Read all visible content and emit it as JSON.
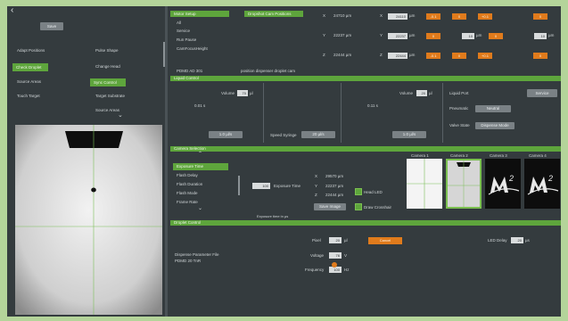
{
  "left_panel": {
    "back_glyph": "‹",
    "save_label": "Save",
    "menu": [
      {
        "label": "Adapt Positions",
        "active": false
      },
      {
        "label": "Pulse Shape",
        "active": false
      },
      {
        "label": "Check Droplet",
        "active": true
      },
      {
        "label": "Change Head",
        "active": false
      },
      {
        "label": "Source Areas",
        "active": false
      },
      {
        "label": "Sync Control",
        "active": true
      },
      {
        "label": "Touch Target",
        "active": false
      },
      {
        "label": "Target Substrate",
        "active": false
      },
      {
        "label": "",
        "active": false
      },
      {
        "label": "Source Areas",
        "active": false
      }
    ],
    "chevron": "⌄"
  },
  "motion": {
    "tabs": [
      "Motor Setup",
      "Dropshot Cam Positions"
    ],
    "list": [
      "All",
      "Service",
      "Run Pause",
      "CamFocusHeight"
    ],
    "axes": [
      {
        "axis": "X",
        "value": "24710 µm",
        "field": "24110",
        "unit": "µm"
      },
      {
        "axis": "Y",
        "value": "22237 µm",
        "field": "22237",
        "unit": "µm"
      },
      {
        "axis": "Z",
        "value": "22444 µm",
        "field": "22444",
        "unit": "µm"
      }
    ],
    "step_buttons_row1": [
      "-0.1",
      "0",
      "+0.1",
      "0"
    ],
    "step_buttons_row3": [
      "-0.1",
      "0",
      "+0.1",
      "0"
    ],
    "mid_fields": [
      "0",
      "10"
    ],
    "right_field": "10",
    "right_unit": "µm",
    "footer_left": "PDMD AD 301",
    "footer_right": "position dispenser droplet cam"
  },
  "liquid": {
    "title": "Liquid Control",
    "volume_label": "Volume",
    "volume_value": "70",
    "volume_unit": "µl",
    "left_value": "0.01 s",
    "mid_value": "0.11 s",
    "aspirate_btn": "1.0 µl/s",
    "speed_label": "Speed Syringe",
    "speed_value": "20 µl/s",
    "volume2_label": "Volume",
    "volume2_value": "20",
    "dispense_btn": "1.0 µl/s",
    "liquid_port_label": "Liquid Port",
    "pneumatic_label": "Pneumatic",
    "pneumatic_value": "Neutral",
    "valve_label": "Valve State",
    "valve_value": "Dispense Mode",
    "service_btn": "Service"
  },
  "camera": {
    "title": "Camera Selection",
    "menu": [
      "Exposure Time",
      "Flash Delay",
      "Flash Duration",
      "Flash Mode",
      "Frame Rate"
    ],
    "exposure_label": "Exposure Time",
    "exposure_value": "100",
    "pos": [
      {
        "axis": "X",
        "value": "29570 µm"
      },
      {
        "axis": "Y",
        "value": "22237 µm"
      },
      {
        "axis": "Z",
        "value": "22444 µm"
      }
    ],
    "head_led": "Head LED",
    "save_image": "Save Image",
    "draw_crosshair": "Draw Crosshair",
    "exposure_hint": "Exposure time in µs",
    "thumbnails": [
      {
        "label": "Camera 1",
        "type": "grid",
        "active": false
      },
      {
        "label": "Camera 2",
        "type": "drop",
        "active": true
      },
      {
        "label": "Camera 3",
        "type": "logo",
        "active": false
      },
      {
        "label": "Camera 4",
        "type": "logo",
        "active": false
      }
    ]
  },
  "droplet": {
    "title": "Droplet Control",
    "pixel_label": "Pixel",
    "pixel_value": "20",
    "pixel_unit": "µl",
    "cancel_btn": "Cancel",
    "led_delay_label": "LED Delay",
    "led_delay_value": "20",
    "led_delay_unit": "µs",
    "param_label": "Dispense Parameter File",
    "param_file": "PDMD 20 TnR",
    "voltage_label": "Voltage",
    "voltage_value": "76",
    "voltage_unit": "V",
    "frequency_label": "Frequency",
    "frequency_value": "100",
    "frequency_unit": "Hz"
  },
  "colors": {
    "accent_green": "#5ea53c",
    "accent_orange": "#e07b1c",
    "panel": "#343b3e",
    "frame": "#b4d49a"
  }
}
